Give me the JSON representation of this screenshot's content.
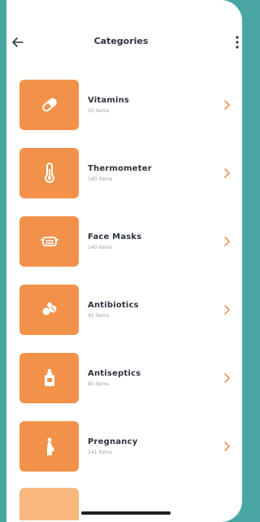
{
  "header": {
    "title": "Categories",
    "back_icon": "arrow-left-icon",
    "menu_icon": "more-vertical-icon"
  },
  "categories": [
    {
      "label": "Vitamins",
      "count": "50 items",
      "icon": "pill-icon"
    },
    {
      "label": "Thermometer",
      "count": "180 items",
      "icon": "thermometer-icon"
    },
    {
      "label": "Face Masks",
      "count": "140 items",
      "icon": "face-mask-icon"
    },
    {
      "label": "Antibiotics",
      "count": "45 items",
      "icon": "capsules-icon"
    },
    {
      "label": "Antiseptics",
      "count": "80 items",
      "icon": "spray-bottle-icon"
    },
    {
      "label": "Pregnancy",
      "count": "141 items",
      "icon": "pregnancy-icon"
    }
  ],
  "colors": {
    "accent": "#f2924a",
    "text": "#2d3440",
    "muted": "#9aa0a6",
    "frame": "#4aa6a2"
  }
}
